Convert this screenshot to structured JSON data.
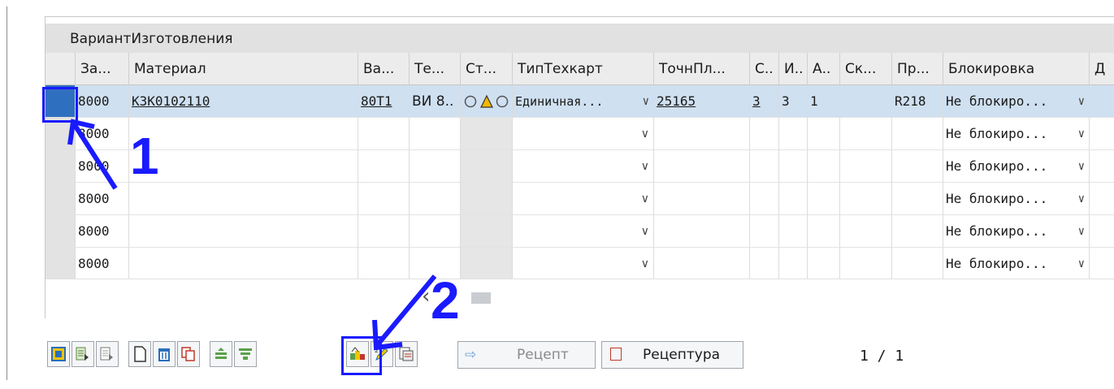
{
  "panel": {
    "title": "ВариантИзготовления"
  },
  "table": {
    "headers": [
      "За...",
      "Материал",
      "Ва...",
      "Те...",
      "Ст...",
      "ТипТехкарт",
      "ТочнПл...",
      "С..",
      "И..",
      "А..",
      "Ск...",
      "Пр...",
      "Блокировка",
      "Д"
    ],
    "first_row": {
      "col0": "8000",
      "material": "КЗК0102110",
      "va": "80T1",
      "te": "ВИ 8..",
      "status_icons": "◯△◯",
      "type": "Единичная...",
      "tochn": "25165",
      "c": "3",
      "i": "3",
      "a": "1",
      "sk": "",
      "pr": "R218",
      "block": "Не блокиро..."
    },
    "empty_rows": [
      {
        "col0": "8000",
        "block": "Не блокиро..."
      },
      {
        "col0": "8000",
        "block": "Не блокиро..."
      },
      {
        "col0": "8000",
        "block": "Не блокиро..."
      },
      {
        "col0": "8000",
        "block": "Не блокиро..."
      },
      {
        "col0": "8000",
        "block": "Не блокиро..."
      }
    ]
  },
  "toolbar": {
    "recept_label": "Рецепт",
    "receptura_label": "Рецептура",
    "icons": [
      "assign-icon",
      "select-all-icon",
      "deselect-all-icon",
      "new-document-icon",
      "delete-icon",
      "copy-icon",
      "align-up-icon",
      "filter-icon",
      "sequence-icon",
      "edit-icon",
      "details-icon",
      "arrow-right-icon",
      "receptura-icon"
    ]
  },
  "pager": {
    "text": "1 / 1"
  },
  "annotations": {
    "one": "1",
    "two": "2",
    "color": "#1a1aff"
  }
}
